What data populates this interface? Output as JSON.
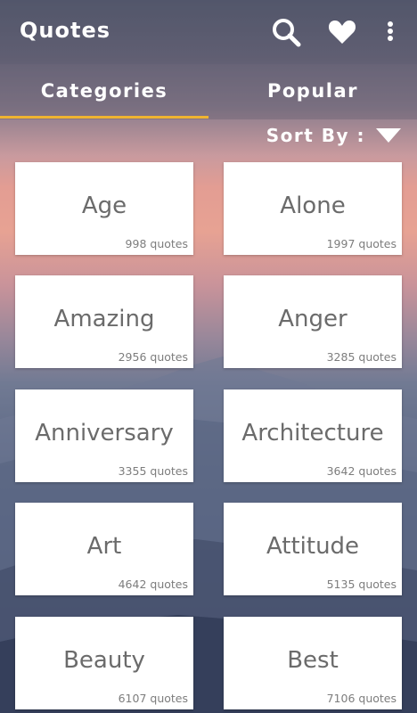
{
  "app": {
    "title": "Quotes",
    "icons": [
      "search-icon",
      "heart-icon",
      "more-vert-icon"
    ],
    "accent_color": "#f0b431"
  },
  "tabs": [
    {
      "label": "Categories",
      "selected": true
    },
    {
      "label": "Popular",
      "selected": false
    }
  ],
  "sort": {
    "label": "Sort By :",
    "icon": "caret-down-icon"
  },
  "categories": [
    {
      "name": "Age",
      "count": "998 quotes"
    },
    {
      "name": "Alone",
      "count": "1997 quotes"
    },
    {
      "name": "Amazing",
      "count": "2956 quotes"
    },
    {
      "name": "Anger",
      "count": "3285 quotes"
    },
    {
      "name": "Anniversary",
      "count": "3355 quotes"
    },
    {
      "name": "Architecture",
      "count": "3642 quotes"
    },
    {
      "name": "Art",
      "count": "4642 quotes"
    },
    {
      "name": "Attitude",
      "count": "5135 quotes"
    },
    {
      "name": "Beauty",
      "count": "6107 quotes"
    },
    {
      "name": "Best",
      "count": "7106 quotes"
    }
  ]
}
